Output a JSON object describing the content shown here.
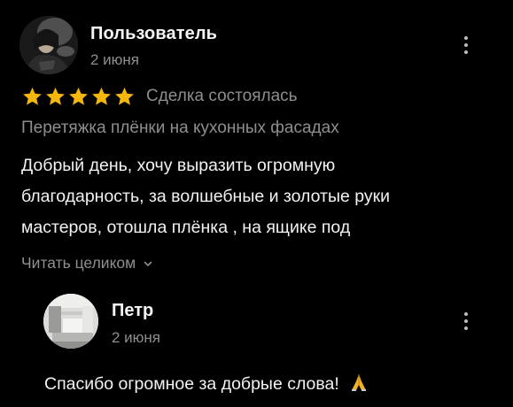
{
  "review": {
    "author": "Пользователь",
    "date": "2 июня",
    "rating": 5,
    "rating_max": 5,
    "deal_status": "Сделка состоялась",
    "service": "Перетяжка плёнки на кухонных фасадах",
    "text_lines": [
      "Добрый день, хочу выразить огромную",
      "благодарность, за волшебные и золотые руки",
      "мастеров, отошла плёнка , на ящике под"
    ],
    "read_more": "Читать целиком",
    "more_icon": "more-vertical-icon"
  },
  "reply": {
    "author": "Петр",
    "date": "2 июня",
    "text": "Спасибо огромное за добрые слова!",
    "emoji_icon": "folded-hands-icon",
    "more_icon": "more-vertical-icon"
  },
  "colors": {
    "background": "#000000",
    "primary_text": "#f2f2f2",
    "secondary_text": "#8e8e8e",
    "star": "#f5b70b"
  }
}
